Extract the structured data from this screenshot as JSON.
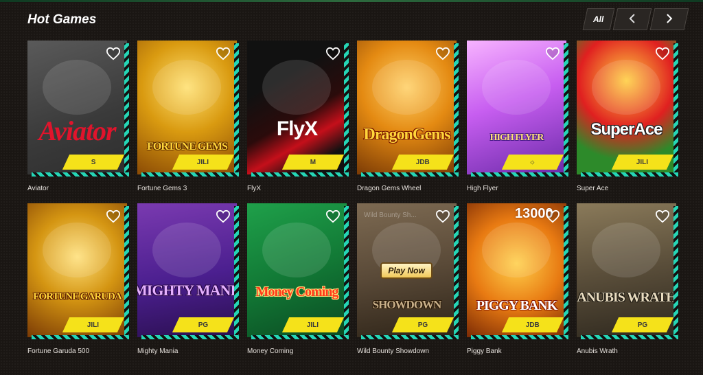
{
  "section": {
    "title": "Hot Games",
    "all_label": "All",
    "prev_icon": "chevron-left-icon",
    "next_icon": "chevron-right-icon"
  },
  "games": [
    {
      "name": "Aviator",
      "art_text": "Aviator",
      "badge": "S",
      "art": "aviator"
    },
    {
      "name": "Fortune Gems 3",
      "art_text": "FORTUNE GEMS",
      "badge": "JILI",
      "art": "gems"
    },
    {
      "name": "FlyX",
      "art_text": "FlyX",
      "badge": "M",
      "art": "flyx"
    },
    {
      "name": "Dragon Gems Wheel",
      "art_text": "DragonGems",
      "badge": "JDB",
      "art": "dragon"
    },
    {
      "name": "High Flyer",
      "art_text": "HIGH FLYER",
      "badge": "☼",
      "art": "flyer"
    },
    {
      "name": "Super Ace",
      "art_text": "SuperAce",
      "badge": "JILI",
      "art": "ace"
    },
    {
      "name": "Fortune Garuda 500",
      "art_text": "FORTUNE GARUDA",
      "badge": "JILI",
      "art": "garuda"
    },
    {
      "name": "Mighty Mania",
      "art_text": "MIGHTY MANIA",
      "badge": "PG",
      "art": "mighty"
    },
    {
      "name": "Money Coming",
      "art_text": "Money Coming",
      "badge": "JILI",
      "art": "money"
    },
    {
      "name": "Wild Bounty Showdown",
      "art_text": "SHOWDOWN",
      "badge": "PG",
      "art": "bounty",
      "play_label": "Play Now",
      "watermark": "Wild Bounty Sh..."
    },
    {
      "name": "Piggy Bank",
      "art_text": "PIGGY BANK",
      "badge": "JDB",
      "art": "piggy",
      "top_number": "13000"
    },
    {
      "name": "Anubis Wrath",
      "art_text": "ANUBIS WRATH",
      "badge": "PG",
      "art": "anubis"
    }
  ],
  "colors": {
    "accent_stripe": "#25d6b6",
    "badge": "#f5e21a",
    "background": "#1a1613"
  }
}
